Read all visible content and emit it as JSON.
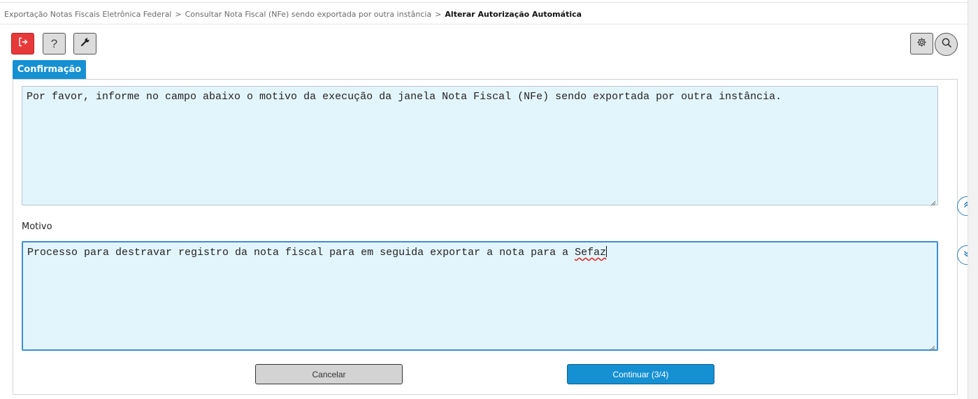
{
  "breadcrumb": {
    "items": [
      "Exportação Notas Fiscais Eletrônica Federal",
      "Consultar Nota Fiscal (NFe) sendo exportada por outra instância"
    ],
    "separator": ">",
    "current": "Alterar Autorização Automática"
  },
  "toolbar": {
    "exit_icon": "exit-icon",
    "help_label": "?",
    "tools_icon": "wrench-icon",
    "settings_icon": "gear-icon",
    "search_icon": "search-icon",
    "exit_color": "#e8393a"
  },
  "tab": {
    "label": "Confirmação",
    "color": "#1590d2"
  },
  "info": {
    "text": "Por favor, informe no campo abaixo o motivo da execução da janela Nota Fiscal (NFe) sendo exportada por outra instância."
  },
  "motivo": {
    "label": "Motivo",
    "value_main": "Processo para destravar registro da nota fiscal para em seguida exportar a nota para a ",
    "value_misspelled": "Sefaz"
  },
  "actions": {
    "cancel_label": "Cancelar",
    "continue_label": "Continuar (3/4)"
  },
  "scroll": {
    "up_icon": "double-chevron-up-icon",
    "down_icon": "double-chevron-down-icon"
  }
}
